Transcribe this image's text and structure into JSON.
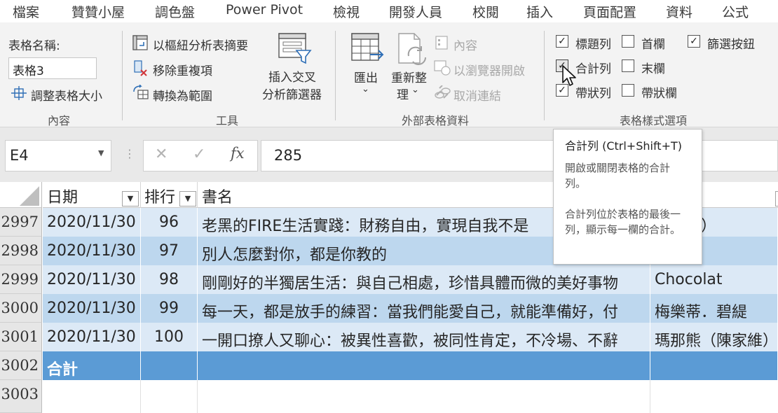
{
  "menu_tabs": [
    "檔案",
    "贊贊小屋",
    "調色盤",
    "Power Pivot",
    "檢視",
    "開發人員",
    "校閱",
    "插入",
    "頁面配置",
    "資料",
    "公式"
  ],
  "ribbon": {
    "properties": {
      "table_name_label": "表格名稱:",
      "table_name_value": "表格3",
      "resize_label": "調整表格大小",
      "group_label": "內容"
    },
    "tools": {
      "pivot_label": "以樞紐分析表摘要",
      "remove_dup_label": "移除重複項",
      "convert_label": "轉換為範圍",
      "slicer_line1": "插入交叉",
      "slicer_line2": "分析篩選器",
      "group_label": "工具"
    },
    "external": {
      "export_label": "匯出",
      "refresh_line1": "重新整",
      "refresh_line2": "理",
      "properties_label": "內容",
      "open_browser_label": "以瀏覽器開啟",
      "unlink_label": "取消連結",
      "group_label": "外部表格資料"
    },
    "style_options": {
      "header_row": {
        "label": "標題列",
        "checked": true
      },
      "total_row": {
        "label": "合計列",
        "checked": true
      },
      "banded_rows": {
        "label": "帶狀列",
        "checked": true
      },
      "first_column": {
        "label": "首欄",
        "checked": false
      },
      "last_column": {
        "label": "末欄",
        "checked": false
      },
      "banded_columns": {
        "label": "帶狀欄",
        "checked": false
      },
      "filter_button": {
        "label": "篩選按鈕",
        "checked": true
      },
      "group_label": "表格樣式選項"
    }
  },
  "formula_bar": {
    "name_box": "E4",
    "value": "285"
  },
  "sheet": {
    "headers": [
      "日期",
      "排行",
      "書名"
    ],
    "rows": [
      {
        "row": "2997",
        "date": "2020/11/30",
        "rank": "96",
        "title": "老黑的FIRE生活實踐：財務自由，實現自我不是",
        "author": "（老黑）"
      },
      {
        "row": "2998",
        "date": "2020/11/30",
        "rank": "97",
        "title": "別人怎麼對你，都是你教的",
        "author": ""
      },
      {
        "row": "2999",
        "date": "2020/11/30",
        "rank": "98",
        "title": "剛剛好的半獨居生活：與自己相處，珍惜具體而微的美好事物",
        "author": "Chocolat"
      },
      {
        "row": "3000",
        "date": "2020/11/30",
        "rank": "99",
        "title": "每一天，都是放手的練習：當我們能愛自己，就能準備好，付",
        "author": "梅樂蒂．碧緹"
      },
      {
        "row": "3001",
        "date": "2020/11/30",
        "rank": "100",
        "title": "一開口撩人又聊心：被異性喜歡，被同性肯定，不冷場、不辭",
        "author": "瑪那熊（陳家維）"
      }
    ],
    "total_row": {
      "row": "3002",
      "label": "合計"
    },
    "empty_row": {
      "row": "3003"
    }
  },
  "tooltip": {
    "title": "合計列 (Ctrl+Shift+T)",
    "line1": "開啟或關閉表格的合計列。",
    "line2": "合計列位於表格的最後一列，顯示每一欄的合計。"
  },
  "colors": {
    "band_light": "#dce9f6",
    "band_dark": "#bdd7ee",
    "total_row": "#5b9bd5",
    "ribbon_bg": "#f3f3f3"
  }
}
